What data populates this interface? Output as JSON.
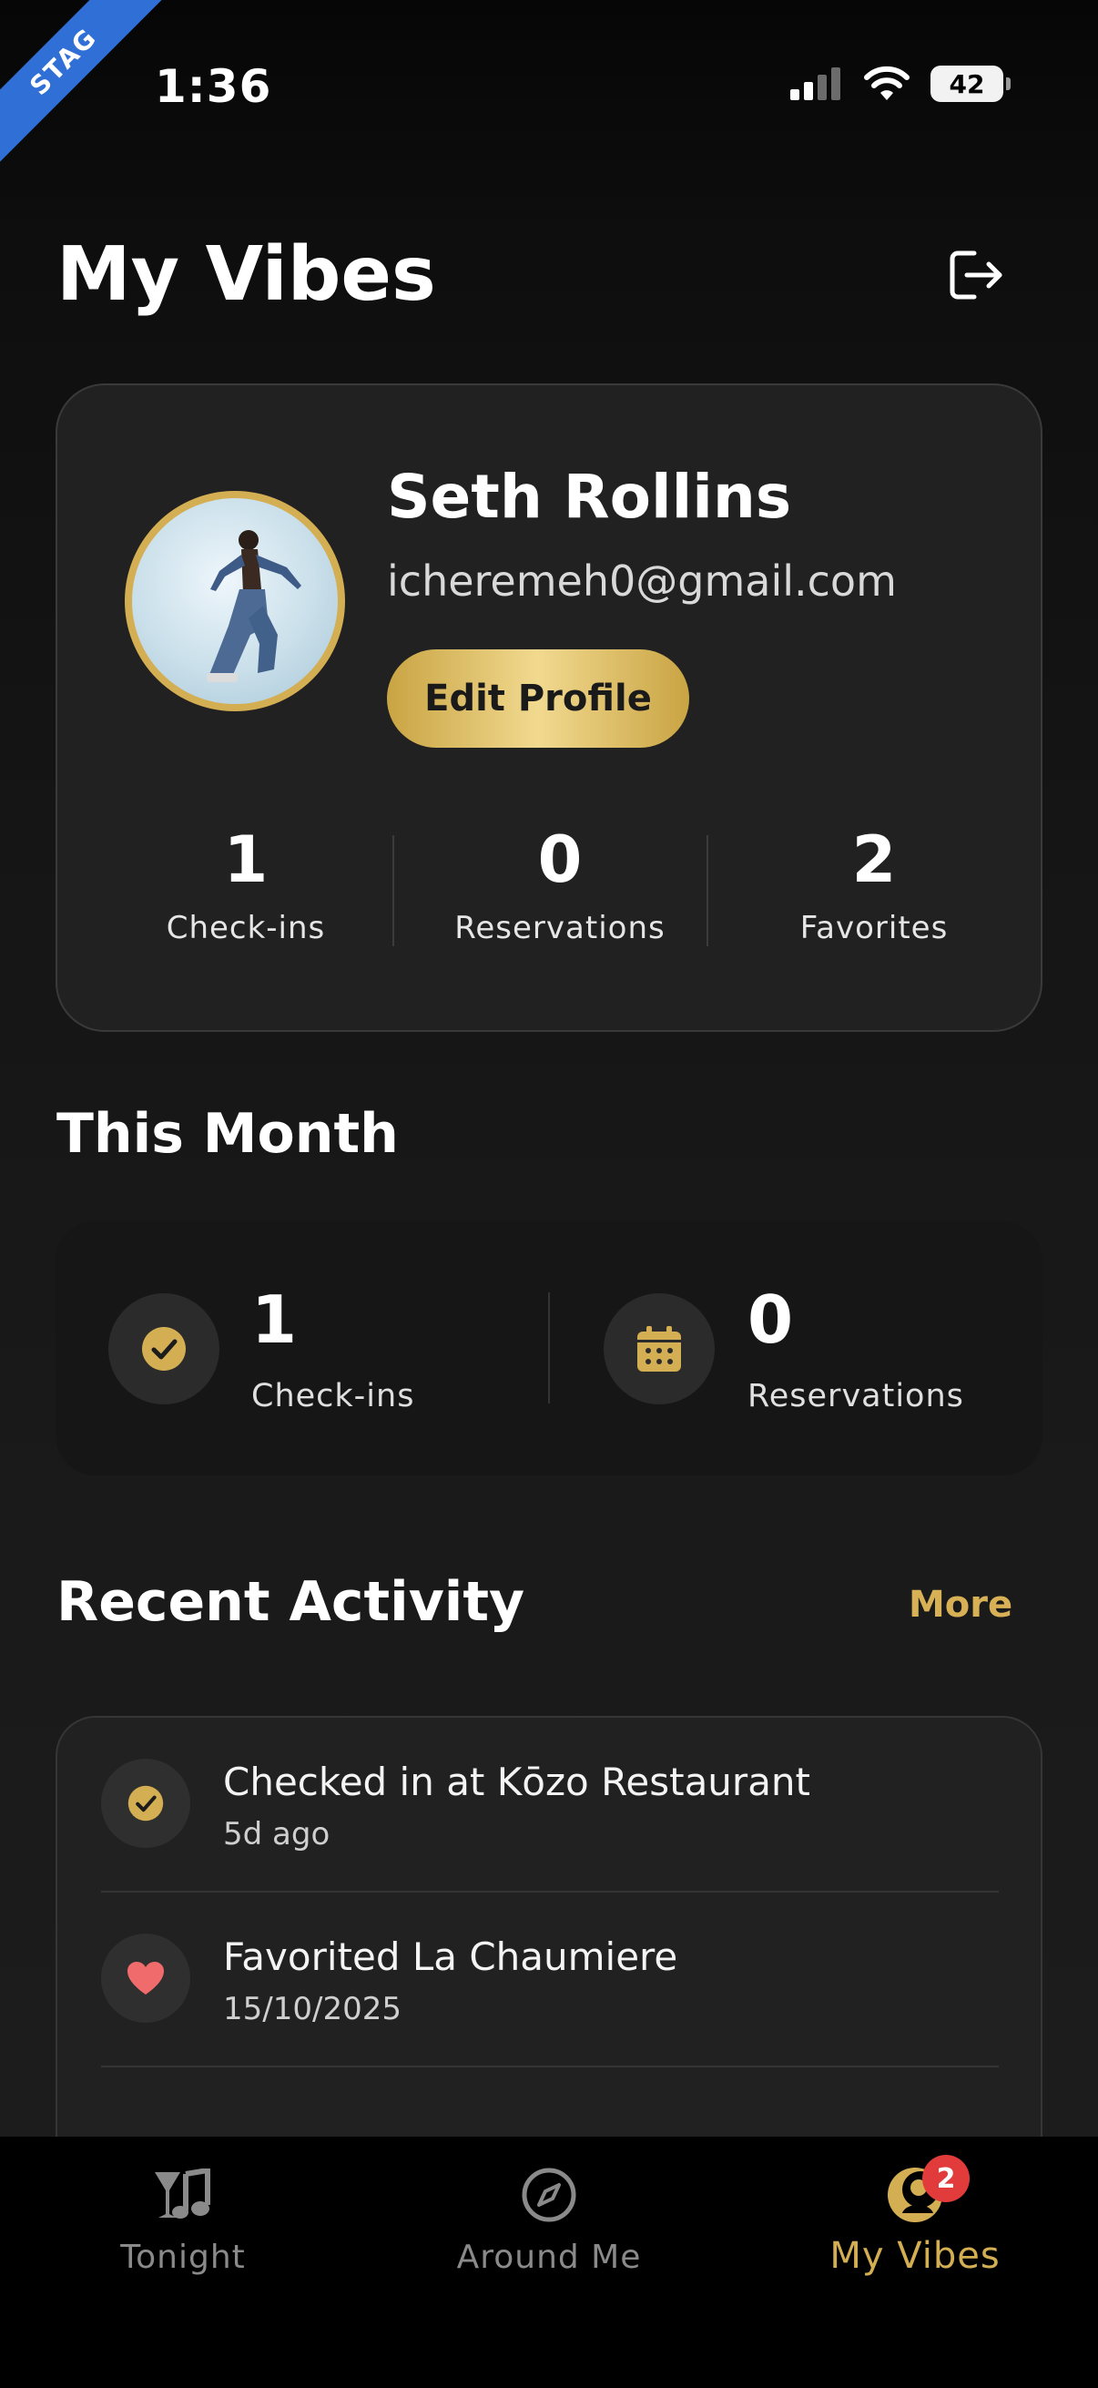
{
  "status_bar": {
    "time": "1:36",
    "battery": "42",
    "env_ribbon": "STAG"
  },
  "header": {
    "title": "My Vibes"
  },
  "profile": {
    "name": "Seth Rollins",
    "email": "icheremeh0@gmail.com",
    "edit_label": "Edit Profile",
    "stats": [
      {
        "value": "1",
        "label": "Check-ins"
      },
      {
        "value": "0",
        "label": "Reservations"
      },
      {
        "value": "2",
        "label": "Favorites"
      }
    ]
  },
  "this_month": {
    "title": "This Month",
    "items": [
      {
        "value": "1",
        "label": "Check-ins",
        "icon": "check-circle-icon"
      },
      {
        "value": "0",
        "label": "Reservations",
        "icon": "calendar-icon"
      }
    ]
  },
  "recent_activity": {
    "title": "Recent Activity",
    "more_label": "More",
    "items": [
      {
        "title": "Checked in at Kōzo Restaurant",
        "time": "5d ago",
        "icon": "check-circle-icon"
      },
      {
        "title": "Favorited La Chaumiere",
        "time": "15/10/2025",
        "icon": "heart-icon"
      }
    ]
  },
  "tab_bar": {
    "tabs": [
      {
        "label": "Tonight",
        "icon": "music-glass-icon"
      },
      {
        "label": "Around Me",
        "icon": "compass-icon"
      },
      {
        "label": "My Vibes",
        "icon": "moon-person-icon",
        "badge": "2",
        "active": true
      }
    ]
  },
  "colors": {
    "accent": "#d4ae52",
    "badge": "#e23b3b",
    "heart": "#f06b6b"
  }
}
